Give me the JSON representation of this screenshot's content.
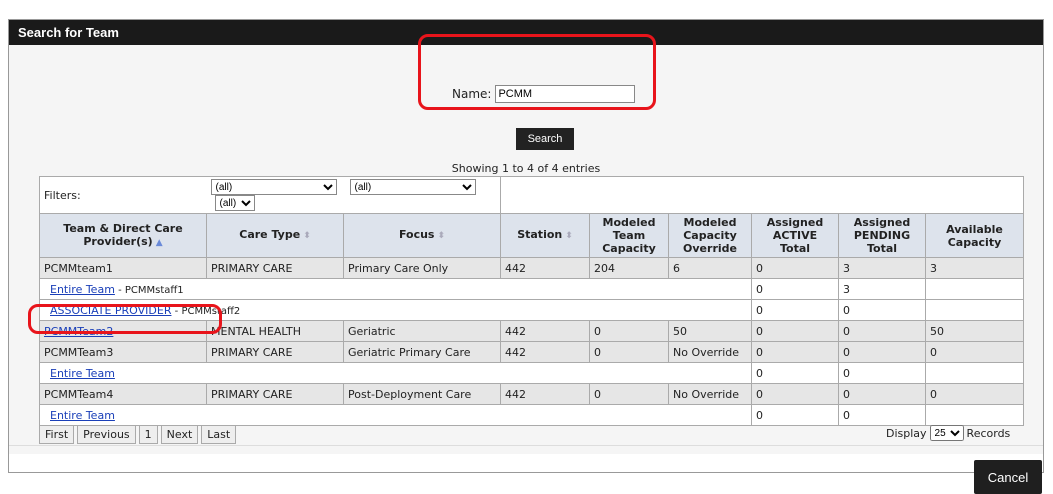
{
  "dialog": {
    "title": "Search for Team"
  },
  "search": {
    "name_label": "Name:",
    "name_value": "PCMM",
    "search_button": "Search"
  },
  "showing": "Showing 1 to 4 of 4 entries",
  "filters": {
    "label": "Filters:",
    "f1": "(all)",
    "f2": "(all)",
    "f3": "(all)"
  },
  "headers": [
    "Team & Direct Care Provider(s)",
    "Care Type",
    "Focus",
    "Station",
    "Modeled Team Capacity",
    "Modeled Capacity Override",
    "Assigned ACTIVE Total",
    "Assigned PENDING Total",
    "Available Capacity"
  ],
  "rows": [
    {
      "team": "PCMMteam1",
      "care": "PRIMARY CARE",
      "focus": "Primary Care Only",
      "station": "442",
      "modeled": "204",
      "override": "6",
      "active": "0",
      "pending": "3",
      "avail": "3"
    },
    {
      "sub_link": "Entire Team",
      "sub_text": " - PCMMstaff1",
      "active": "0",
      "pending": "3"
    },
    {
      "sub_link": "ASSOCIATE PROVIDER",
      "sub_text": " - PCMMstaff2",
      "active": "0",
      "pending": "0"
    },
    {
      "team": "PCMMTeam2",
      "care": "MENTAL HEALTH",
      "focus": "Geriatric",
      "station": "442",
      "modeled": "0",
      "override": "50",
      "active": "0",
      "pending": "0",
      "avail": "50"
    },
    {
      "team": "PCMMTeam3",
      "care": "PRIMARY CARE",
      "focus": "Geriatric Primary Care",
      "station": "442",
      "modeled": "0",
      "override": "No Override",
      "active": "0",
      "pending": "0",
      "avail": "0"
    },
    {
      "sub_link": "Entire Team",
      "active": "0",
      "pending": "0"
    },
    {
      "team": "PCMMTeam4",
      "care": "PRIMARY CARE",
      "focus": "Post-Deployment Care",
      "station": "442",
      "modeled": "0",
      "override": "No Override",
      "active": "0",
      "pending": "0",
      "avail": "0"
    },
    {
      "sub_link": "Entire Team",
      "active": "0",
      "pending": "0"
    }
  ],
  "pager": {
    "first": "First",
    "previous": "Previous",
    "page": "1",
    "next": "Next",
    "last": "Last"
  },
  "display": {
    "label": "Display",
    "value": "25",
    "suffix": "Records"
  },
  "cancel": "Cancel"
}
